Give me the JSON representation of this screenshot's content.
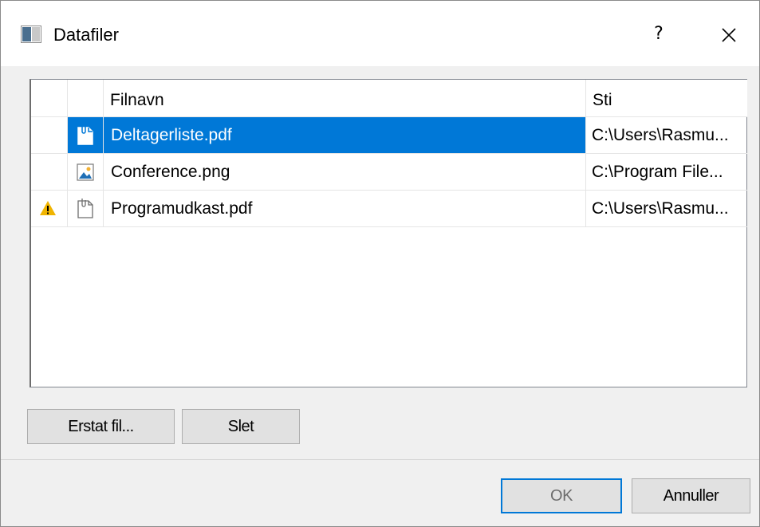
{
  "window": {
    "title": "Datafiler",
    "help_label": "?",
    "close_icon": "close-icon"
  },
  "list": {
    "columns": [
      "",
      "",
      "Filnavn",
      "Sti"
    ],
    "rows": [
      {
        "status_icon": "",
        "type_icon": "pdf-file-icon",
        "filename": "Deltagerliste.pdf",
        "path": "C:\\Users\\Rasmu...",
        "selected": true
      },
      {
        "status_icon": "",
        "type_icon": "image-file-icon",
        "filename": "Conference.png",
        "path": "C:\\Program File...",
        "selected": false
      },
      {
        "status_icon": "warning-icon",
        "type_icon": "pdf-file-icon",
        "filename": "Programudkast.pdf",
        "path": "C:\\Users\\Rasmu...",
        "selected": false
      }
    ]
  },
  "buttons": {
    "replace": "Erstat fil...",
    "delete": "Slet",
    "ok": "OK",
    "cancel": "Annuller"
  },
  "colors": {
    "selection": "#0078d7",
    "warning": "#f0b400"
  }
}
